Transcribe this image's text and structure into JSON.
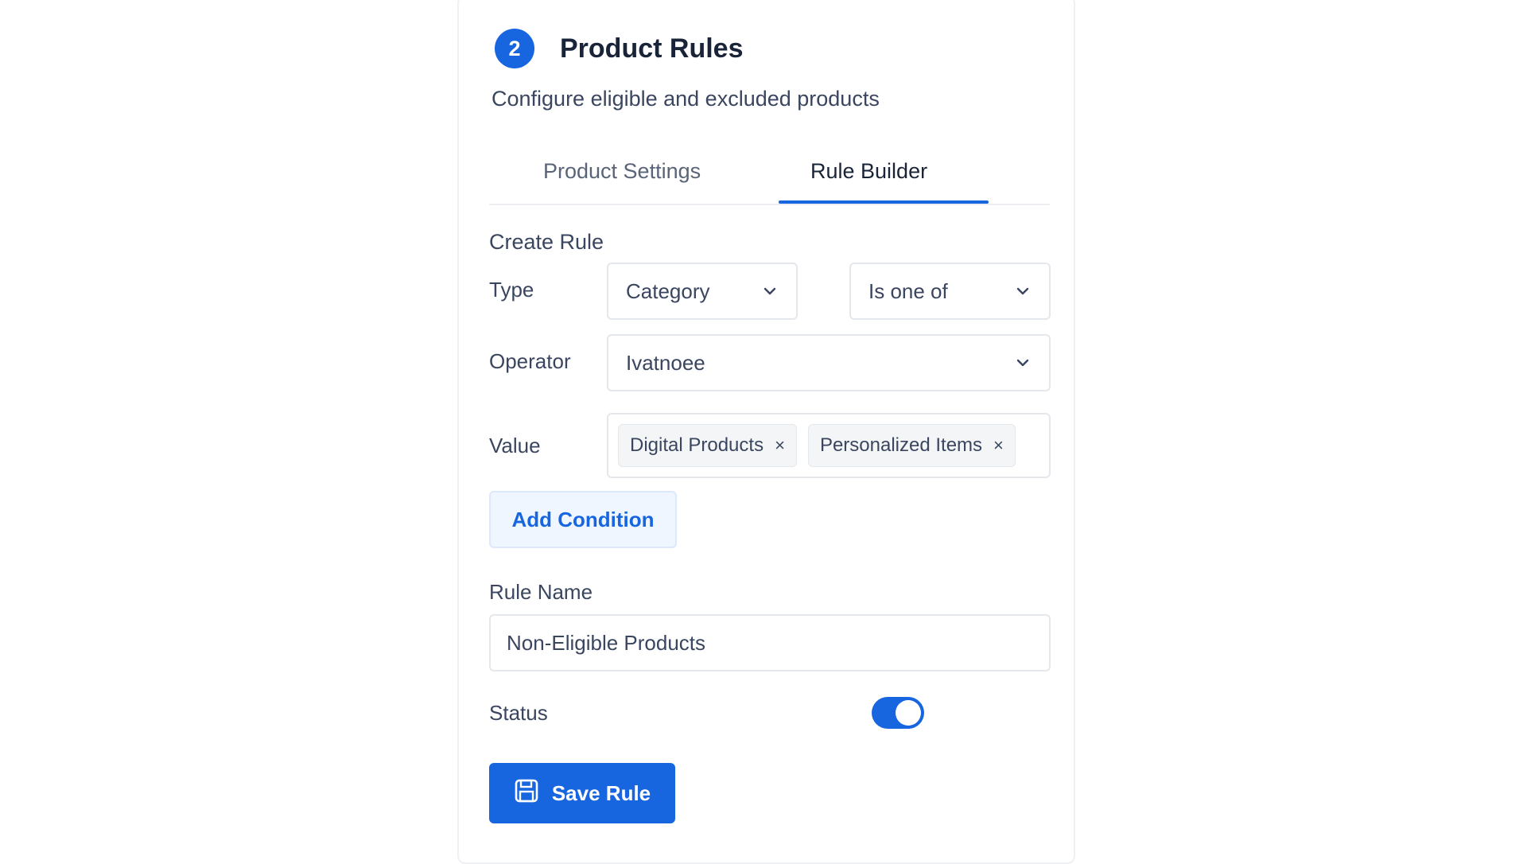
{
  "header": {
    "step_number": "2",
    "title": "Product Rules",
    "subtitle": "Configure eligible and excluded products"
  },
  "tabs": [
    {
      "label": "Product Settings",
      "active": false
    },
    {
      "label": "Rule Builder",
      "active": true
    }
  ],
  "rule": {
    "section_label": "Create Rule",
    "type_label": "Type",
    "type_value": "Category",
    "condition_value": "Is one of",
    "operator_label": "Operator",
    "operator_value": "Ivatnoee",
    "value_label": "Value",
    "tags": [
      {
        "label": "Digital Products",
        "remove": "×"
      },
      {
        "label": "Personalized Items",
        "remove": "×"
      }
    ],
    "add_condition_label": "Add Condition"
  },
  "rule_name": {
    "label": "Rule Name",
    "value": "Non-Eligible Products"
  },
  "status": {
    "label": "Status",
    "enabled": true
  },
  "save": {
    "label": "Save Rule",
    "icon": "save-icon"
  },
  "colors": {
    "accent": "#1766e0",
    "text": "#1a2438",
    "border": "#e4e7ec"
  }
}
